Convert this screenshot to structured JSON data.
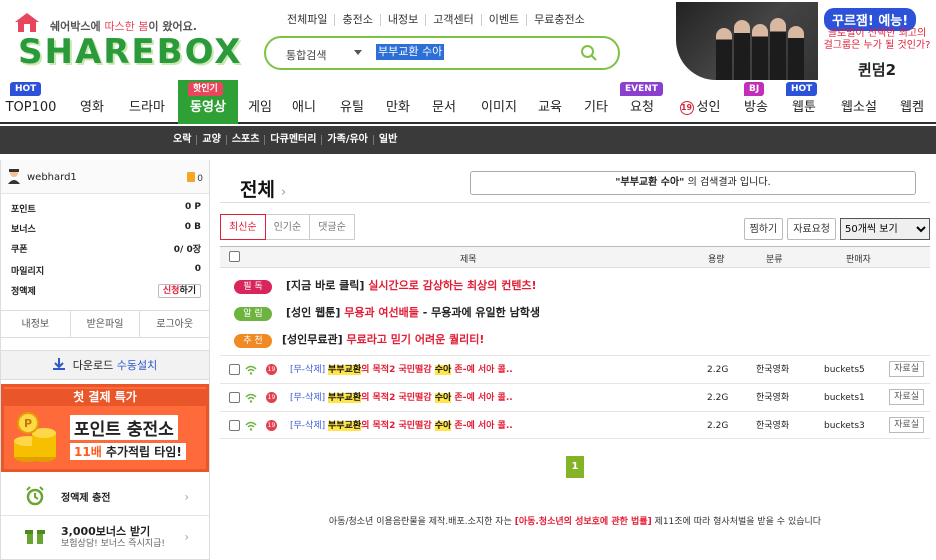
{
  "brand": {
    "tagline_prefix": "쉐어박스에 ",
    "tagline_highlight": "따스한 봄",
    "tagline_suffix": "이 왔어요.",
    "logo_text": "SHAREBOX"
  },
  "top_menu": [
    "전체파일",
    "충전소",
    "내정보",
    "고객센터",
    "이벤트",
    "무료충전소"
  ],
  "search": {
    "category": "통합검색",
    "query": "부부교환 수아"
  },
  "banner": {
    "badge": "꾸르잼! 예능!",
    "line1": "글로벌이 선택한 최고의",
    "line2": "걸그룹은 누가 될 것인가?",
    "title": "퀸덤2"
  },
  "categories": [
    {
      "label": "TOP100",
      "badge": "HOT"
    },
    {
      "label": "영화"
    },
    {
      "label": "드라마"
    },
    {
      "label": "동영상",
      "badge": "핫인기"
    },
    {
      "label": "게임"
    },
    {
      "label": "애니"
    },
    {
      "label": "유틸"
    },
    {
      "label": "만화"
    },
    {
      "label": "문서"
    },
    {
      "label": "이미지"
    },
    {
      "label": "교육"
    },
    {
      "label": "기타"
    },
    {
      "label": "요청",
      "badge": "EVENT"
    },
    {
      "label": "성인",
      "age": "19"
    },
    {
      "label": "방송",
      "badge": "BJ"
    },
    {
      "label": "웹툰",
      "badge": "HOT"
    },
    {
      "label": "웹소설"
    },
    {
      "label": "웹켐"
    }
  ],
  "subnav": [
    "오락",
    "교양",
    "스포츠",
    "다큐멘터리",
    "가족/유아",
    "일반"
  ],
  "sidebar": {
    "username": "webhard1",
    "coupon_count": "0",
    "stats": [
      {
        "label": "포인트",
        "value": "0 P"
      },
      {
        "label": "보너스",
        "value": "0 B"
      },
      {
        "label": "쿠폰",
        "value": "0/ 0장"
      },
      {
        "label": "마일리지",
        "value": "0"
      }
    ],
    "plan_label": "정액제",
    "charge_red": "신청",
    "charge_rest": "하기",
    "tabs": [
      "내정보",
      "받은파일",
      "로그아웃"
    ],
    "download_label": "다운로드 ",
    "download_highlight": "수동설치",
    "promo": {
      "title": "첫 결제 특가",
      "big": "포인트 충전소",
      "small_num": "11배",
      "small_rest": " 추가적립 타임!"
    },
    "link1": "정액제 충전",
    "link2_title": "3,000보너스 받기",
    "link2_sub": "보험상담! 보너스 즉시지급!"
  },
  "main": {
    "title": "전체",
    "notice_query": "\"부부교환 수아\"",
    "notice_rest": " 의 검색결과 입니다.",
    "sort_tabs": [
      "최신순",
      "인기순",
      "댓글순"
    ],
    "buttons": [
      "찜하기",
      "자료요청"
    ],
    "view_select": "50개씩 보기",
    "headers": {
      "title": "제목",
      "size": "용량",
      "category": "분류",
      "seller": "판매자"
    },
    "ads": [
      {
        "pill": "필 독",
        "color": "#d8265a",
        "text_prefix": "[지금 바로 클릭] ",
        "text_red": "실시간으로 감상하는 최상의 컨텐츠!",
        "text_suffix": ""
      },
      {
        "pill": "알 림",
        "color": "#6db33f",
        "text_prefix": "[성인 웹툰] ",
        "text_red": "무용과 여선배들",
        "text_suffix": " - 무용과에 유일한 남학생"
      },
      {
        "pill": "추 천",
        "color": "#f08a24",
        "text_prefix": "[성인무료관] ",
        "text_red": "무료라고 믿기 어려운 퀄리티!",
        "text_suffix": ""
      }
    ],
    "files": [
      {
        "prefix": "[무-삭제] ",
        "hl1": "부부교환",
        "mid": "의 목적2 국민떨감 ",
        "hl2": "수아",
        "tail": " 존-예 서아 콜..",
        "size": "2.2G",
        "category": "한국영화",
        "seller": "buckets5",
        "action": "자료실"
      },
      {
        "prefix": "[무-삭제] ",
        "hl1": "부부교환",
        "mid": "의 목적2 국민떨감 ",
        "hl2": "수아",
        "tail": " 존-예 서아 콜..",
        "size": "2.2G",
        "category": "한국영화",
        "seller": "buckets1",
        "action": "자료실"
      },
      {
        "prefix": "[무-삭제] ",
        "hl1": "부부교환",
        "mid": "의 목적2 국민떨감 ",
        "hl2": "수아",
        "tail": " 존-예 서아 콜..",
        "size": "2.2G",
        "category": "한국영화",
        "seller": "buckets3",
        "action": "자료실"
      }
    ],
    "page": "1",
    "legal_prefix": "아동/청소년 이용음란물을 제작.배포.소지한 자는 ",
    "legal_red": "[아동.청소년의 성보호에 관한 법률]",
    "legal_suffix": " 제11조에 따라 형사처벌을 받을 수 있습니다"
  }
}
